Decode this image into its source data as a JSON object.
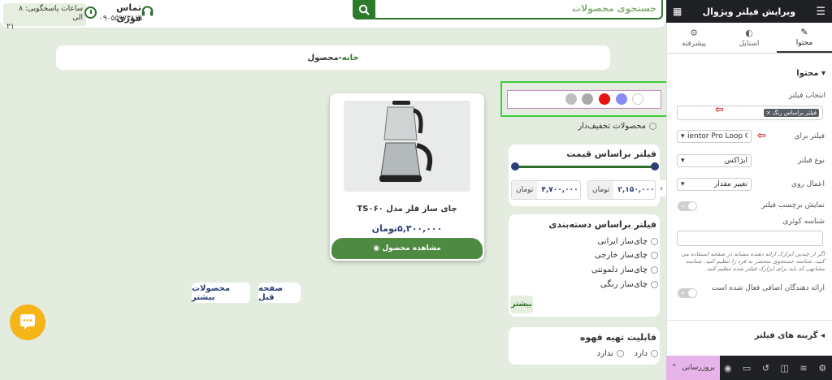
{
  "header": {
    "search_placeholder": "جستجوی محصولات",
    "contact_title": "تماس فوری",
    "contact_phone": "۰۹۰۵۵۹۷۳۸۱۹",
    "hours_label": "ساعات پاسخگویی: ۸ الی",
    "hours_end": "۲۱"
  },
  "breadcrumb": {
    "home": "خانه",
    "separator": " - ",
    "current": "محصول"
  },
  "filters": {
    "colors": [
      "#ffffff",
      "#8a8af5",
      "#e81212",
      "#aaaaaa",
      "#bdbdbd"
    ],
    "discount_label": "محصولات تخفیف‌دار",
    "price": {
      "title": "فیلتر براساس قیمت",
      "min_value": "۲,۱۵۰,۰۰۰",
      "max_value": "۴,۷۰۰,۰۰۰",
      "unit": "تومان"
    },
    "category": {
      "title": "فیلتر براساس دسته‌بندی",
      "items": [
        "چای‌ساز ایرانی",
        "چای‌ساز خارجی",
        "چای‌ساز دلمونتی",
        "چای‌ساز رنگی"
      ],
      "more": "بیشتر"
    },
    "coffee": {
      "title": "قابلیت تهیه قهوه",
      "yes": "دارد",
      "no": "ندارد"
    }
  },
  "product": {
    "name": "چای ساز فلر مدل TS۰۶۰",
    "price": "۵,۳۰۰,۰۰۰تومان",
    "view_button": "مشاهده محصول"
  },
  "pagination": {
    "prev": "صفحه قبل",
    "more": "محصولات بیشتر"
  },
  "editor": {
    "title": "ویرایش فیلتر ویژوال",
    "tabs": {
      "content": "محتوا",
      "style": "استایل",
      "advanced": "پیشرفته"
    },
    "section_content": "محتوا",
    "select_filter_label": "انتخاب فیلتر",
    "selected_filter_tag": "× فیلتر براساس رنگ",
    "filter_for_label": "فیلتر برای",
    "filter_for_value": "ientor Pro Loop Grid",
    "filter_type_label": "نوع فیلتر",
    "filter_type_value": "ایژاکس",
    "apply_on_label": "اعمال روی",
    "apply_on_value": "تغییر مقدار",
    "show_label_label": "نمایش برچسب فیلتر",
    "query_id_label": "شناسه کوئری",
    "query_help": "اگر از چندین ابزارک ارائه دهنده مشابه در صفحه استفاده می کنید، شناسه جستجوی منحصر به فرد را تنظیم کنید. شناسه مشابهی که باید برای ابزارک فیلتر شده تنظیم کنید.",
    "extra_providers_label": "ارائه دهندگان اضافی فعال شده است",
    "toggle_off": "نه",
    "filter_options": "گزینه های فیلتر",
    "update_button": "بروزرسانی"
  }
}
